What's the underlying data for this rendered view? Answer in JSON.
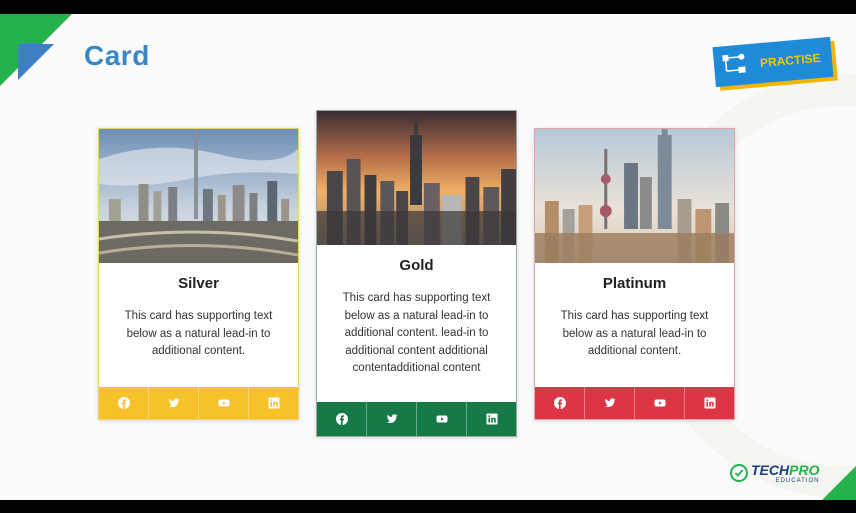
{
  "page": {
    "title": "Card"
  },
  "badge": {
    "label": "PRACTISE",
    "icon": "flowchart-icon"
  },
  "cards": [
    {
      "title": "Silver",
      "text": "This card has supporting text below as a natural lead-in to additional content.",
      "accent": "#f7c12a",
      "image": "dubai-skyline-image"
    },
    {
      "title": "Gold",
      "text": "This card has supporting text below as a natural lead-in to additional content. lead-in to additional content additional contentadditional content",
      "accent": "#157a47",
      "image": "new-york-skyline-image"
    },
    {
      "title": "Platinum",
      "text": "This card has supporting text below as a natural lead-in to additional content.",
      "accent": "#dc3545",
      "image": "shanghai-skyline-image"
    }
  ],
  "social_icons": [
    "facebook-icon",
    "twitter-icon",
    "youtube-icon",
    "linkedin-icon"
  ],
  "logo": {
    "main": "TECH",
    "accent": "PRO",
    "sub": "EDUCATION"
  }
}
